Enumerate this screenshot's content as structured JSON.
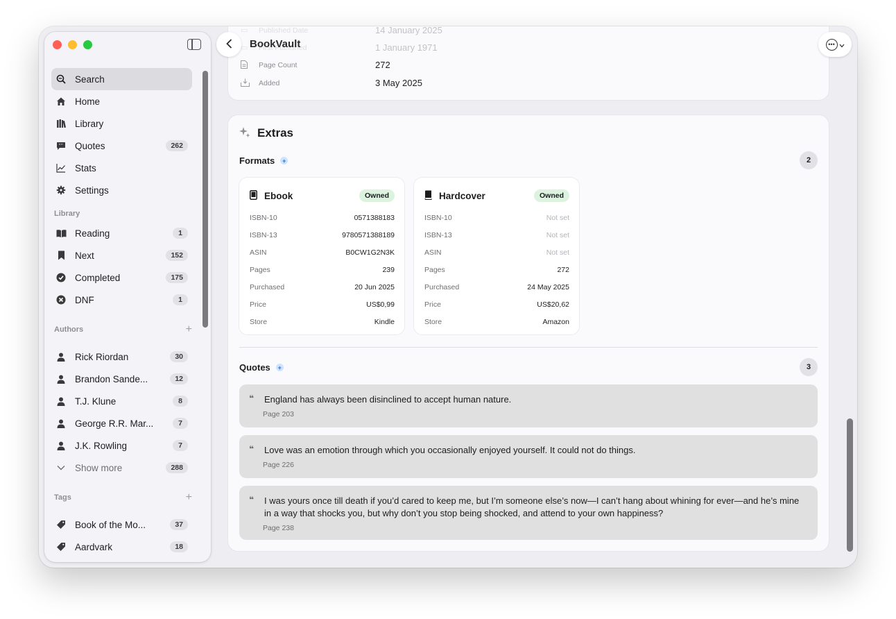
{
  "app": {
    "title": "BookVault"
  },
  "sidebar": {
    "nav": [
      {
        "label": "Search",
        "icon": "search-icon"
      },
      {
        "label": "Home",
        "icon": "home-icon"
      },
      {
        "label": "Library",
        "icon": "library-icon"
      },
      {
        "label": "Quotes",
        "icon": "quote-icon",
        "count": "262"
      },
      {
        "label": "Stats",
        "icon": "chart-icon"
      },
      {
        "label": "Settings",
        "icon": "gear-icon"
      }
    ],
    "library_title": "Library",
    "library": [
      {
        "label": "Reading",
        "icon": "book-open-icon",
        "count": "1"
      },
      {
        "label": "Next",
        "icon": "bookmark-icon",
        "count": "152"
      },
      {
        "label": "Completed",
        "icon": "checkmark-circle-icon",
        "count": "175"
      },
      {
        "label": "DNF",
        "icon": "x-circle-icon",
        "count": "1"
      }
    ],
    "authors_title": "Authors",
    "authors": [
      {
        "label": "Rick Riordan",
        "count": "30"
      },
      {
        "label": "Brandon Sande...",
        "count": "12"
      },
      {
        "label": "T.J. Klune",
        "count": "8"
      },
      {
        "label": "George R.R. Mar...",
        "count": "7"
      },
      {
        "label": "J.K. Rowling",
        "count": "7"
      }
    ],
    "authors_more": {
      "label": "Show more",
      "count": "288"
    },
    "tags_title": "Tags",
    "tags": [
      {
        "label": "Book of the Mo...",
        "count": "37"
      },
      {
        "label": "Aardvark",
        "count": "18"
      }
    ]
  },
  "details": {
    "rows": [
      {
        "label": "Published Date",
        "value": "14 January 2025"
      },
      {
        "label": "First Published",
        "value": "1 January 1971"
      },
      {
        "label": "Page Count",
        "value": "272"
      },
      {
        "label": "Added",
        "value": "3 May 2025"
      }
    ]
  },
  "extras": {
    "title": "Extras",
    "formats_label": "Formats",
    "formats_count": "2",
    "formats": [
      {
        "name": "Ebook",
        "status": "Owned",
        "fields": [
          {
            "label": "ISBN-10",
            "value": "0571388183"
          },
          {
            "label": "ISBN-13",
            "value": "9780571388189"
          },
          {
            "label": "ASIN",
            "value": "B0CW1G2N3K"
          },
          {
            "label": "Pages",
            "value": "239"
          },
          {
            "label": "Purchased",
            "value": "20 Jun 2025"
          },
          {
            "label": "Price",
            "value": "US$0,99"
          },
          {
            "label": "Store",
            "value": "Kindle"
          }
        ]
      },
      {
        "name": "Hardcover",
        "status": "Owned",
        "fields": [
          {
            "label": "ISBN-10",
            "value": "Not set"
          },
          {
            "label": "ISBN-13",
            "value": "Not set"
          },
          {
            "label": "ASIN",
            "value": "Not set"
          },
          {
            "label": "Pages",
            "value": "272"
          },
          {
            "label": "Purchased",
            "value": "24 May 2025"
          },
          {
            "label": "Price",
            "value": "US$20,62"
          },
          {
            "label": "Store",
            "value": "Amazon"
          }
        ]
      }
    ],
    "quotes_label": "Quotes",
    "quotes_count": "3",
    "quotes": [
      {
        "text": "England has always been disinclined to accept human nature.",
        "page": "Page 203"
      },
      {
        "text": "Love was an emotion through which you occasionally enjoyed yourself. It could not do things.",
        "page": "Page 226"
      },
      {
        "text": "I was yours once till death if you’d cared to keep me, but I’m someone else’s now—I can’t hang about whining for ever—and he’s mine in a way that shocks you, but why don’t you stop being shocked, and attend to your own happiness?",
        "page": "Page 238"
      }
    ]
  },
  "colors": {
    "owned_badge": "#dcf3df",
    "quote_bg": "#e0e0e0",
    "add_accent": "#1a73e8"
  }
}
